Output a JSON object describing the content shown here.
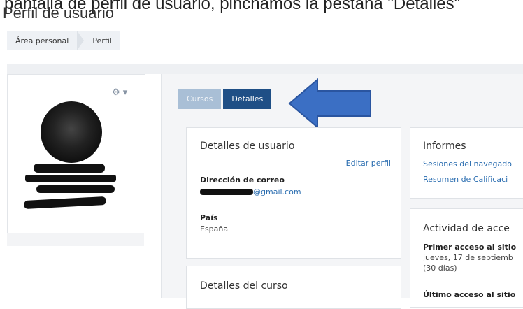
{
  "caption": "pantalla de perfil de usuario, pinchamos la pestaña \"Detalles\"",
  "page_title": "Perfil de usuario",
  "breadcrumb": [
    "Área personal",
    "Perfil"
  ],
  "tabs": [
    {
      "label": "Cursos",
      "active": false
    },
    {
      "label": "Detalles",
      "active": true
    }
  ],
  "user_details": {
    "title": "Detalles de usuario",
    "edit_link": "Editar perfil",
    "email_label": "Dirección de correo",
    "email_suffix": "@gmail.com",
    "country_label": "País",
    "country_value": "España"
  },
  "course_details": {
    "title": "Detalles del curso"
  },
  "reports": {
    "title": "Informes",
    "links": [
      "Sesiones del navegado",
      "Resumen de Calificaci"
    ]
  },
  "activity": {
    "title": "Actividad de acce",
    "first_access_label": "Primer acceso al sitio",
    "first_access_value": "jueves, 17 de septiemb",
    "first_access_ago": "(30 días)",
    "last_access_label": "Último acceso al sitio"
  },
  "colors": {
    "tab_active": "#1f4f86",
    "tab_inactive": "#a9bfd6",
    "link": "#2a6db0",
    "arrow": "#3b6fc4"
  }
}
